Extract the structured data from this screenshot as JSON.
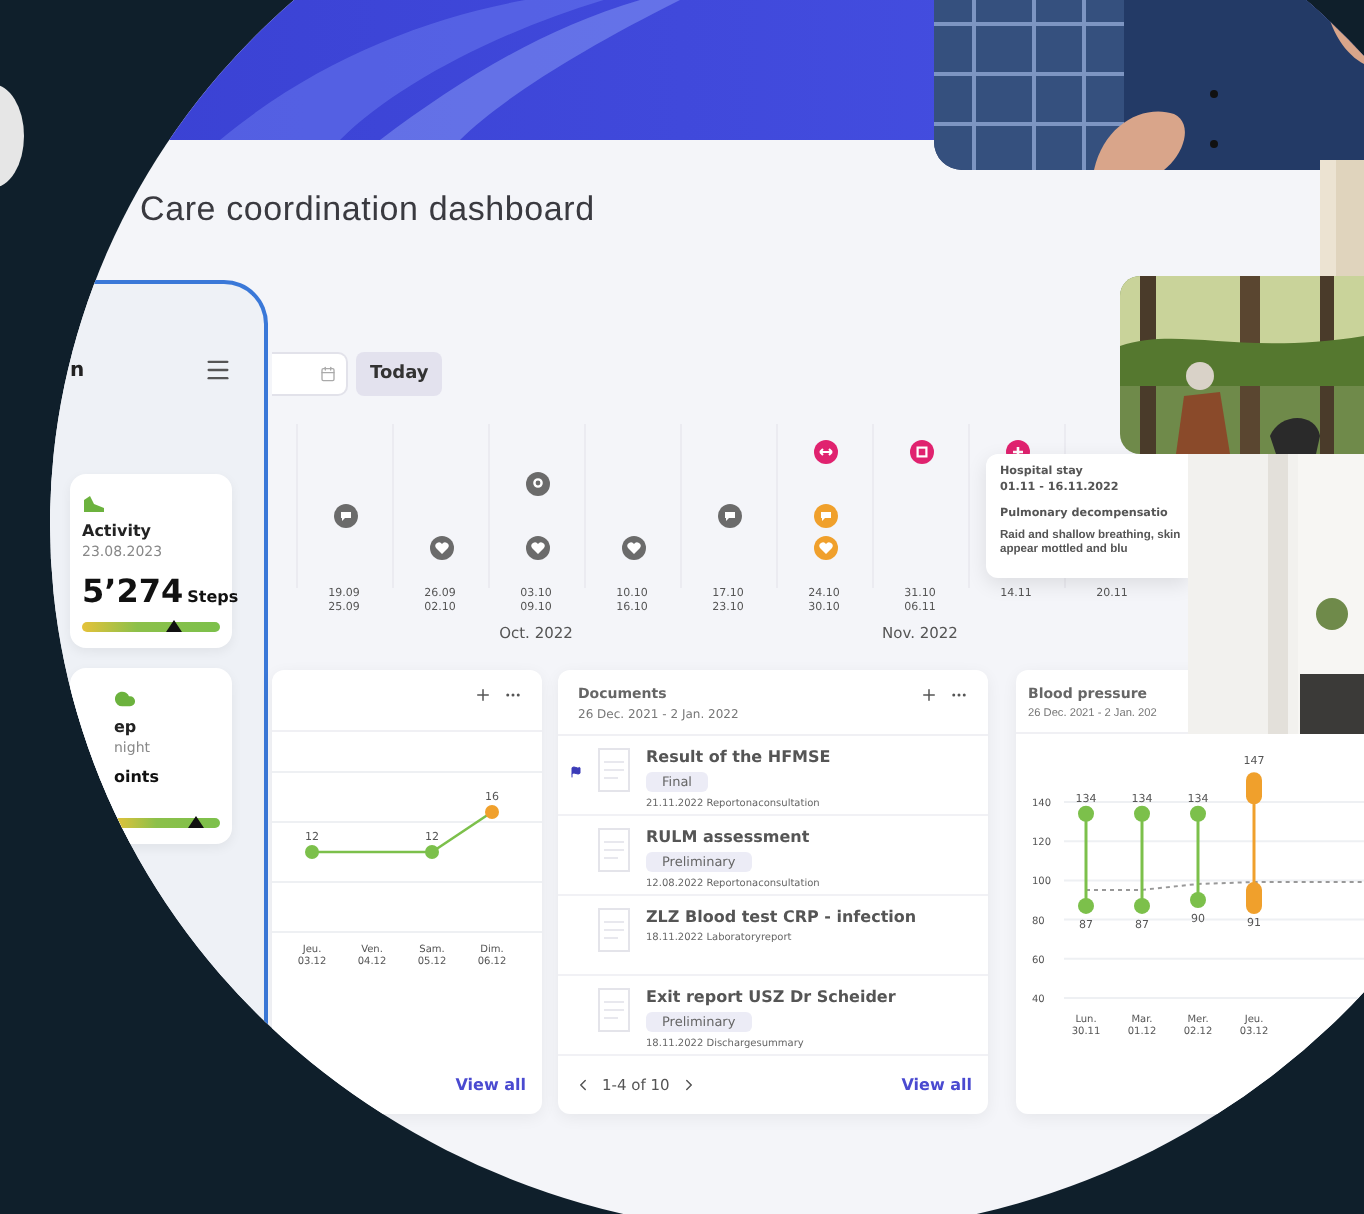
{
  "title": "Care coordination dashboard",
  "phone": {
    "title": "n",
    "cards": [
      {
        "kind": "activity",
        "label": "Activity",
        "date": "23.08.2023",
        "value": "5’274",
        "unit": "Steps",
        "level": 0.66
      },
      {
        "kind": "sleep",
        "label": "ep",
        "date": "night",
        "value": "oints",
        "level": 0.78
      }
    ]
  },
  "toolbar": {
    "today_button": "Today"
  },
  "timeline": {
    "columns": [
      {
        "dates": [
          "19.09",
          "25.09"
        ],
        "events": [
          {
            "kind": "chat",
            "color": "#6b6b6b"
          }
        ]
      },
      {
        "dates": [
          "26.09",
          "02.10"
        ],
        "events": [
          {
            "kind": "heart",
            "color": "#6b6b6b"
          }
        ]
      },
      {
        "dates": [
          "03.10",
          "09.10"
        ],
        "month": "Oct. 2022",
        "events": [
          {
            "kind": "pin",
            "color": "#6b6b6b"
          },
          {
            "kind": "heart",
            "color": "#6b6b6b"
          }
        ]
      },
      {
        "dates": [
          "10.10",
          "16.10"
        ],
        "events": [
          {
            "kind": "heart",
            "color": "#6b6b6b"
          }
        ]
      },
      {
        "dates": [
          "17.10",
          "23.10"
        ],
        "events": [
          {
            "kind": "chat",
            "color": "#6b6b6b"
          }
        ]
      },
      {
        "dates": [
          "24.10",
          "30.10"
        ],
        "events": [
          {
            "kind": "transfer",
            "color": "#e0226f"
          },
          {
            "kind": "chat",
            "color": "#f0a02c"
          },
          {
            "kind": "heart",
            "color": "#f0a02c"
          }
        ]
      },
      {
        "dates": [
          "31.10",
          "06.11"
        ],
        "month": "Nov. 2022",
        "events": [
          {
            "kind": "square",
            "color": "#e0226f"
          }
        ]
      },
      {
        "dates": [
          "14.11"
        ],
        "events": [
          {
            "kind": "plus",
            "color": "#e0226f"
          }
        ]
      },
      {
        "dates": [
          "20.11"
        ]
      }
    ],
    "tooltip": {
      "title": "Hospital stay",
      "dates": "01.11 - 16.11.2022",
      "heading": "Pulmonary decompensatio",
      "body": "Raid and shallow breathing, skin appear mottled and blu"
    }
  },
  "trend_card": {
    "link": "View all",
    "points": [
      {
        "axis_label": "Jeu. 03.12",
        "value_label": "12"
      },
      {
        "axis_label": "Ven. 04.12"
      },
      {
        "axis_label": "Sam. 05.12",
        "value_label": "12"
      },
      {
        "axis_label": "Dim. 06.12",
        "value_label": "16"
      }
    ]
  },
  "documents": {
    "title": "Documents",
    "range": "26 Dec. 2021 - 2 Jan. 2022",
    "items": [
      {
        "title": "Result of the HFMSE",
        "status": "Final",
        "meta": "21.11.2022 Reportonaconsultation",
        "flagged": true
      },
      {
        "title": "RULM assessment",
        "status": "Preliminary",
        "meta": "12.08.2022 Reportonaconsultation",
        "flagged": false
      },
      {
        "title": "ZLZ Blood test CRP - infection",
        "meta": "18.11.2022 Laboratoryreport",
        "flagged": false
      },
      {
        "title": "Exit report USZ Dr Scheider",
        "status": "Preliminary",
        "meta": "18.11.2022 Dischargesummary",
        "flagged": false
      }
    ],
    "pagination": "1-4 of 10",
    "link": "View all"
  },
  "blood_pressure": {
    "title": "Blood pressure",
    "range": "26 Dec. 2021 - 2 Jan. 202",
    "y_labels": [
      "140",
      "120",
      "100",
      "80",
      "60",
      "40"
    ],
    "readings": [
      {
        "day": "Lun. 30.11",
        "high": "134",
        "low": "87",
        "alert": false
      },
      {
        "day": "Mar. 01.12",
        "high": "134",
        "low": "87",
        "alert": false
      },
      {
        "day": "Mer. 02.12",
        "high": "134",
        "low": "90",
        "alert": false
      },
      {
        "day": "Jeu. 03.12",
        "high": "147",
        "low": "91",
        "alert": true
      }
    ]
  }
}
